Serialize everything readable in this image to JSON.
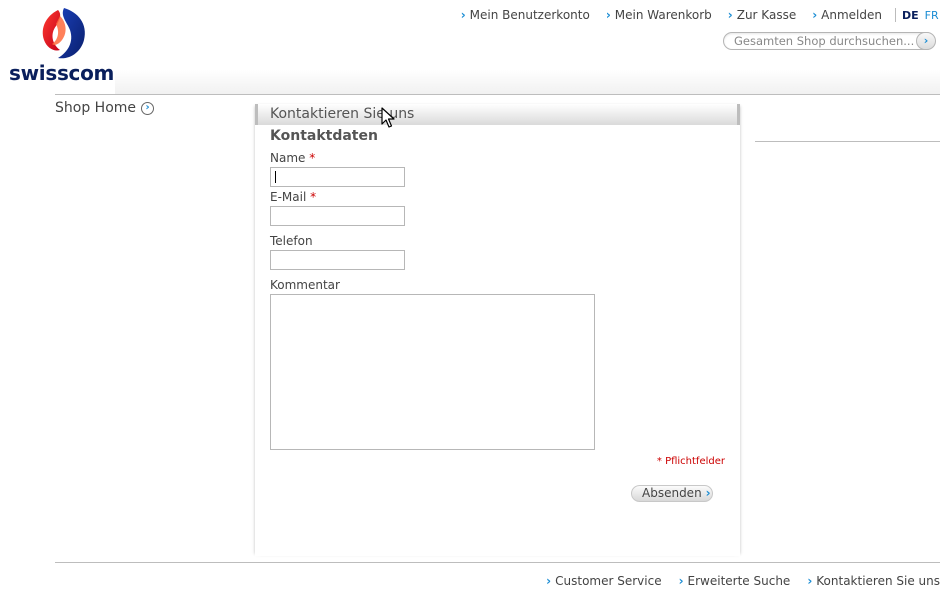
{
  "brand": {
    "name": "swisscom"
  },
  "topnav": {
    "items": [
      {
        "label": "Mein Benutzerkonto"
      },
      {
        "label": "Mein Warenkorb"
      },
      {
        "label": "Zur Kasse"
      },
      {
        "label": "Anmelden"
      }
    ]
  },
  "language": {
    "de": "DE",
    "fr": "FR"
  },
  "search": {
    "placeholder": "Gesamten Shop durchsuchen...",
    "button": "›"
  },
  "sidebar": {
    "shop_home": "Shop Home"
  },
  "panel": {
    "title": "Kontaktieren Sie uns",
    "section": "Kontaktdaten",
    "fields": {
      "name_label": "Name",
      "email_label": "E-Mail",
      "phone_label": "Telefon",
      "comment_label": "Kommentar",
      "required_mark": "*"
    },
    "required_note": "* Pflichtfelder",
    "submit": "Absenden"
  },
  "footer": {
    "items": [
      {
        "label": "Customer Service"
      },
      {
        "label": "Erweiterte Suche"
      },
      {
        "label": "Kontaktieren Sie uns"
      }
    ]
  },
  "colors": {
    "accent": "#1b8dd4",
    "brand_navy": "#0a1f5c",
    "required": "#cc0000"
  }
}
